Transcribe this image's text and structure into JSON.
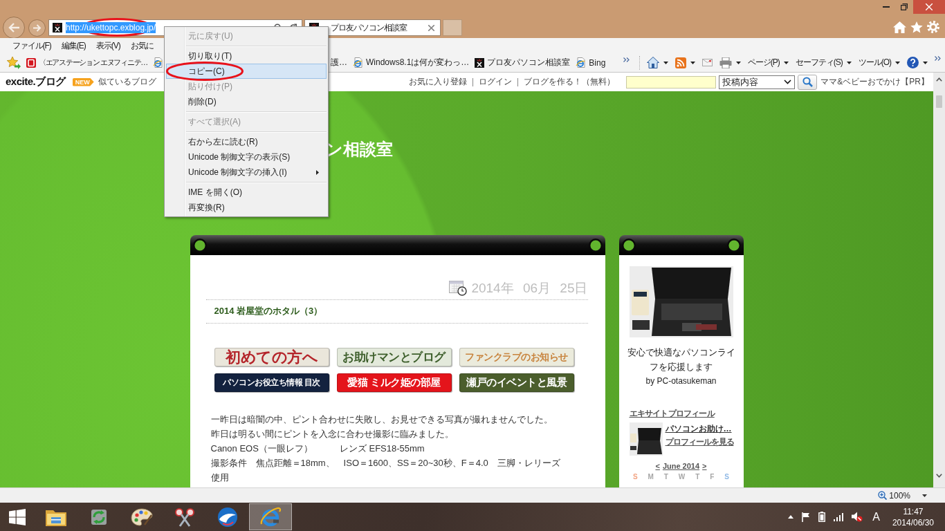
{
  "browser": {
    "address_bar": {
      "url": "http://ukettopc.exblog.jp/",
      "text_selected": true,
      "circled": true
    },
    "tabs": [
      {
        "title": "プロ友パソコン相談室",
        "selected": true
      }
    ],
    "menu_bar": [
      "ファイル(F)",
      "編集(E)",
      "表示(V)",
      "お気に"
    ],
    "favorites": [
      {
        "kind": "tile",
        "label": "〈エアステーション エヌフィニテ…"
      },
      {
        "kind": "e_page"
      },
      {
        "kind": "text",
        "label": "護…"
      },
      {
        "kind": "e_page",
        "label": "Windows8.1は何が変わっ…"
      },
      {
        "kind": "favicon",
        "label": "プロ友パソコン相談室"
      },
      {
        "kind": "e_page",
        "label": "Bing"
      }
    ],
    "command_bar": [
      {
        "kind": "home",
        "dropdown": true
      },
      {
        "kind": "feed",
        "dropdown": true
      },
      {
        "kind": "mail",
        "dropdown": false
      },
      {
        "kind": "print",
        "dropdown": true
      },
      {
        "kind": "text",
        "label": "ページ(P)",
        "dropdown": true
      },
      {
        "kind": "text",
        "label": "セーフティ(S)",
        "dropdown": true
      },
      {
        "kind": "text",
        "label": "ツール(O)",
        "dropdown": true
      },
      {
        "kind": "help",
        "dropdown": true
      }
    ]
  },
  "site_header": {
    "logo": "excite.ブログ",
    "new_badge": "NEW",
    "similar_link": "似ているブログ",
    "links": [
      "お気に入り登録",
      "ログイン",
      "ブログを作る！（無料）"
    ],
    "search_select": "投稿内容",
    "pr_link": "ママ&ベビーおでかけ【PR】"
  },
  "blog": {
    "title": "ン相談室",
    "post": {
      "date": "2014年 06月 25日",
      "title": "2014 岩屋堂のホタル（3）",
      "banners": [
        {
          "label": "初めての方へ",
          "kind": "light",
          "color": "#b4242a"
        },
        {
          "label": "お助けマンとブログ",
          "kind": "light",
          "color": "#3e5f2c"
        },
        {
          "label": "ファンクラブのお知らせ",
          "kind": "light",
          "color": "#c8843e"
        },
        {
          "label": "パソコンお役立ち情報 目次",
          "kind": "dark",
          "color": "#13223f"
        },
        {
          "label": "愛猫 ミルク姫の部屋",
          "kind": "dark",
          "color": "#e4141b"
        },
        {
          "label": "瀬戸のイベントと風景",
          "kind": "dark",
          "color": "#4b5e2c"
        }
      ],
      "paragraphs": [
        "一昨日は暗闇の中、ピント合わせに失敗し、お見せできる写真が撮れませんでした。",
        "昨日は明るい間にピントを入念に合わせ撮影に臨みました。",
        "Canon EOS（一眼レフ）　　　レンズ EFS18-55mm",
        "撮影条件　焦点距離＝18mm、　ISO＝1600、SS＝20~30秒、F＝4.0　三脚・レリーズ使用"
      ]
    },
    "sidebar": {
      "tagline": "安心で快適なパソコンライフを応援します",
      "byline": "by PC-otasukeman",
      "profile_heading": "エキサイトプロフィール",
      "profile_name": "パソコンお助け…",
      "profile_link": "プロフィールを見る",
      "calendar": {
        "prev": "<",
        "month": "June 2014",
        "next": ">",
        "weekdays": [
          {
            "label": "S",
            "color": "#f2a382"
          },
          {
            "label": "M",
            "color": "#a6a6a6"
          },
          {
            "label": "T",
            "color": "#a6a6a6"
          },
          {
            "label": "W",
            "color": "#a6a6a6"
          },
          {
            "label": "T",
            "color": "#a6a6a6"
          },
          {
            "label": "F",
            "color": "#a6a6a6"
          },
          {
            "label": "S",
            "color": "#8fb9e6"
          }
        ]
      }
    }
  },
  "context_menu": {
    "items": [
      {
        "kind": "item",
        "label": "元に戻す(U)",
        "disabled": true,
        "selected": false,
        "circled": false,
        "submenu": false
      },
      {
        "kind": "separator"
      },
      {
        "kind": "item",
        "label": "切り取り(T)",
        "disabled": false,
        "selected": false,
        "circled": false,
        "submenu": false
      },
      {
        "kind": "item",
        "label": "コピー(C)",
        "disabled": false,
        "selected": true,
        "circled": true,
        "submenu": false
      },
      {
        "kind": "item",
        "label": "貼り付け(P)",
        "disabled": true,
        "selected": false,
        "circled": false,
        "submenu": false
      },
      {
        "kind": "item",
        "label": "削除(D)",
        "disabled": false,
        "selected": false,
        "circled": false,
        "submenu": false
      },
      {
        "kind": "separator"
      },
      {
        "kind": "item",
        "label": "すべて選択(A)",
        "disabled": true,
        "selected": false,
        "circled": false,
        "submenu": false
      },
      {
        "kind": "separator"
      },
      {
        "kind": "item",
        "label": "右から左に読む(R)",
        "disabled": false,
        "selected": false,
        "circled": false,
        "submenu": false
      },
      {
        "kind": "item",
        "label": "Unicode 制御文字の表示(S)",
        "disabled": false,
        "selected": false,
        "circled": false,
        "submenu": false
      },
      {
        "kind": "item",
        "label": "Unicode 制御文字の挿入(I)",
        "disabled": false,
        "selected": false,
        "circled": false,
        "submenu": true
      },
      {
        "kind": "separator"
      },
      {
        "kind": "item",
        "label": "IME を開く(O)",
        "disabled": false,
        "selected": false,
        "circled": false,
        "submenu": false
      },
      {
        "kind": "item",
        "label": "再変換(R)",
        "disabled": false,
        "selected": false,
        "circled": false,
        "submenu": false
      }
    ]
  },
  "status_bar": {
    "zoom": "100%"
  },
  "taskbar": {
    "apps": [
      {
        "kind": "folder",
        "selected": false
      },
      {
        "kind": "sync",
        "selected": false
      },
      {
        "kind": "palette",
        "selected": false
      },
      {
        "kind": "scissors",
        "selected": false
      },
      {
        "kind": "sphere",
        "selected": false
      },
      {
        "kind": "browser",
        "selected": true
      }
    ],
    "ime": "A",
    "time": "11:47",
    "date": "2014/06/30"
  }
}
